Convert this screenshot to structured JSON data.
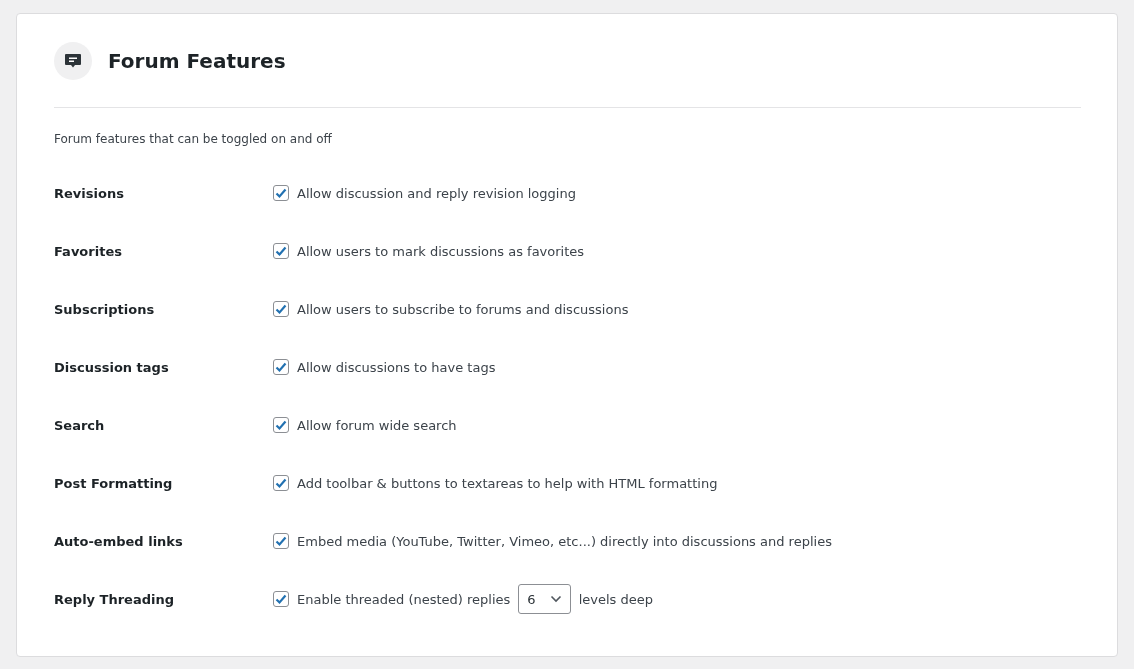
{
  "panel": {
    "title": "Forum Features",
    "description": "Forum features that can be toggled on and off"
  },
  "settings": [
    {
      "kind": "checkbox",
      "label": "Revisions",
      "checked": true,
      "text": "Allow discussion and reply revision logging"
    },
    {
      "kind": "checkbox",
      "label": "Favorites",
      "checked": true,
      "text": "Allow users to mark discussions as favorites"
    },
    {
      "kind": "checkbox",
      "label": "Subscriptions",
      "checked": true,
      "text": "Allow users to subscribe to forums and discussions"
    },
    {
      "kind": "checkbox",
      "label": "Discussion tags",
      "checked": true,
      "text": "Allow discussions to have tags"
    },
    {
      "kind": "checkbox",
      "label": "Search",
      "checked": true,
      "text": "Allow forum wide search"
    },
    {
      "kind": "checkbox",
      "label": "Post Formatting",
      "checked": true,
      "text": "Add toolbar & buttons to textareas to help with HTML formatting"
    },
    {
      "kind": "checkbox",
      "label": "Auto-embed links",
      "checked": true,
      "text": "Embed media (YouTube, Twitter, Vimeo, etc...) directly into discussions and replies"
    },
    {
      "kind": "select",
      "label": "Reply Threading",
      "checked": true,
      "text": "Enable threaded (nested) replies",
      "value": "6",
      "suffix": "levels deep"
    }
  ]
}
